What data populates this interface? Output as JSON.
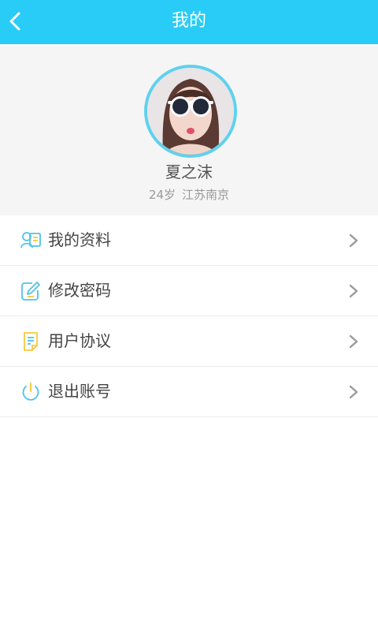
{
  "header": {
    "title": "我的"
  },
  "profile": {
    "name": "夏之沫",
    "age": "24岁",
    "location": "江苏南京"
  },
  "menu": {
    "items": [
      {
        "label": "我的资料",
        "icon": "profile-card-icon"
      },
      {
        "label": "修改密码",
        "icon": "edit-icon"
      },
      {
        "label": "用户协议",
        "icon": "document-icon"
      },
      {
        "label": "退出账号",
        "icon": "power-icon"
      }
    ]
  },
  "colors": {
    "header_bg": "#29ccf7",
    "accent": "#4fc3e8",
    "icon_yellow": "#f5c842",
    "profile_bg": "#f5f5f5"
  }
}
